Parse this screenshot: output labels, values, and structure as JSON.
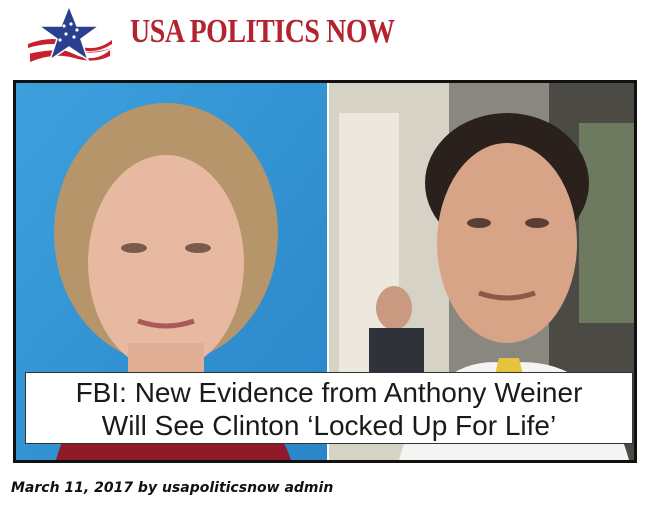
{
  "site": {
    "brand_part1": "USA POLITICS",
    "brand_part2": "NOW",
    "brand_color": "#b32430",
    "logo_icon": "star-flag-icon"
  },
  "article": {
    "headline_line1": "FBI: New Evidence from Anthony Weiner",
    "headline_line2": "Will See Clinton ‘Locked Up For Life’",
    "byline": "March 11, 2017 by usapoliticsnow admin"
  }
}
